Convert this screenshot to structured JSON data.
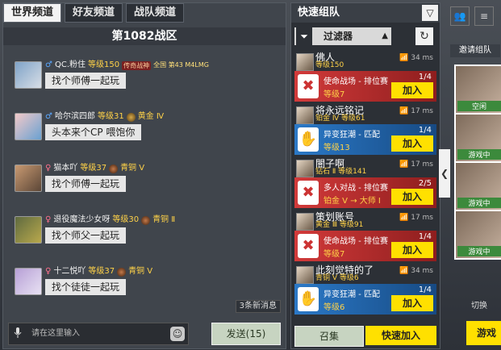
{
  "chat": {
    "tabs": [
      "世界频道",
      "好友频道",
      "战队频道"
    ],
    "title": "第1082战区",
    "messages": [
      {
        "name": "QC.粉住",
        "level": "等级150",
        "rank": "",
        "badge": "传奇战神",
        "badge2": "全国 第43 M4LMG",
        "text": "找个师傅一起玩",
        "sex": "m"
      },
      {
        "name": "哈尔滨四郎",
        "level": "等级31",
        "rank": "黄金 Ⅳ",
        "badge": "",
        "badge2": "",
        "text": "头本来个CP 喂饱你",
        "sex": "m"
      },
      {
        "name": "猫本吖",
        "level": "等级37",
        "rank": "青铜 Ⅴ",
        "badge": "",
        "badge2": "",
        "text": "找个师傅一起玩",
        "sex": "f"
      },
      {
        "name": "退役魔法少女呀",
        "level": "等级30",
        "rank": "青铜 Ⅱ",
        "badge": "",
        "badge2": "",
        "text": "找个师父一起玩",
        "sex": "f"
      },
      {
        "name": "十二悦吖",
        "level": "等级37",
        "rank": "青铜 Ⅴ",
        "badge": "",
        "badge2": "",
        "text": "找个徒徒一起玩",
        "sex": "f"
      }
    ],
    "new_messages": "3条新消息",
    "input_placeholder": "请在这里输入",
    "send_label": "发送(15)"
  },
  "team": {
    "title": "快速组队",
    "filter_label": "过滤器",
    "items": [
      {
        "name": "佛人",
        "sub": "等级150",
        "ping": "34 ms",
        "mode": "使命战场 - 排位赛",
        "mode_level": "等级7",
        "slots": "1/4",
        "color": "red",
        "join": "加入"
      },
      {
        "name": "将永远铭记",
        "sub": "铂金 Ⅳ  等级61",
        "ping": "17 ms",
        "mode": "异变狂潮 - 匹配",
        "mode_level": "等级13",
        "slots": "1/4",
        "color": "blue",
        "join": "加入"
      },
      {
        "name": "闇子啊",
        "sub": "钻石 Ⅱ  等级141",
        "ping": "17 ms",
        "mode": "多人对战 - 排位赛",
        "mode_level": "铂金 Ⅴ → 大师 Ⅰ",
        "slots": "2/5",
        "color": "red",
        "join": "加入"
      },
      {
        "name": "策划账号",
        "sub": "黄金 Ⅲ  等级91",
        "ping": "17 ms",
        "mode": "使命战场 - 排位赛",
        "mode_level": "等级7",
        "slots": "1/4",
        "color": "red",
        "join": "加入"
      },
      {
        "name": "此刻觉特的了",
        "sub": "青铜 Ⅴ  等级6",
        "ping": "34 ms",
        "mode": "异变狂潮 - 匹配",
        "mode_level": "等级6",
        "slots": "1/4",
        "color": "blue",
        "join": "加入"
      }
    ],
    "summon_label": "召集",
    "quick_join_label": "快速加入"
  },
  "side": {
    "invite_label": "邀请组队",
    "slots": [
      "空闲",
      "游戏中",
      "游戏中",
      "游戏中"
    ],
    "switch_label": "切换",
    "game_label": "游戏"
  }
}
